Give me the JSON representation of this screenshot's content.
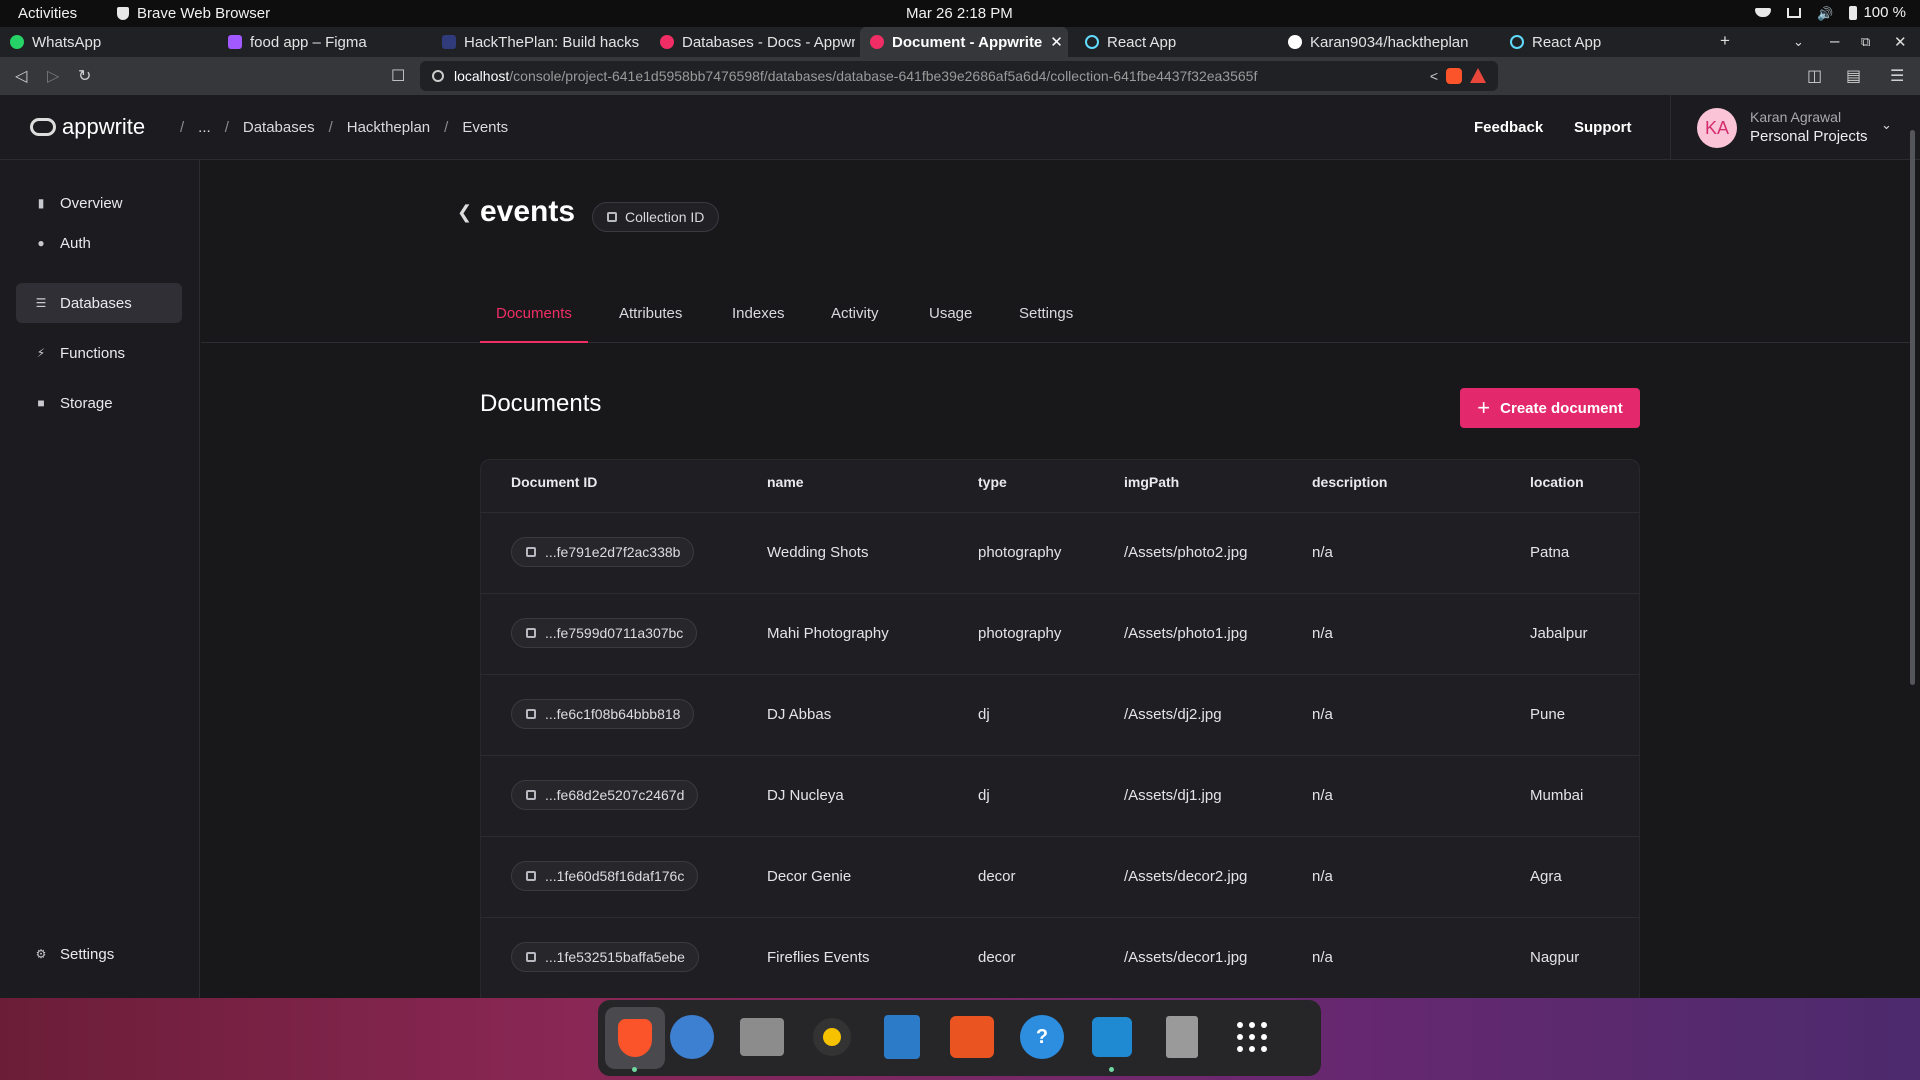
{
  "system": {
    "activities": "Activities",
    "app_name": "Brave Web Browser",
    "clock": "Mar 26  2:18 PM",
    "battery": "100 %"
  },
  "browser": {
    "tabs": [
      {
        "title": "WhatsApp",
        "color": "#25d366"
      },
      {
        "title": "food app – Figma",
        "color": "#a259ff"
      },
      {
        "title": "HackThePlan: Build hacks",
        "color": "#2f3b7a"
      },
      {
        "title": "Databases - Docs - Appwri",
        "color": "#f02e65"
      },
      {
        "title": "Document - Appwrite",
        "color": "#f02e65"
      },
      {
        "title": "React App",
        "color": "#61dafb"
      },
      {
        "title": "Karan9034/hacktheplan",
        "color": "#ffffff"
      },
      {
        "title": "React App",
        "color": "#61dafb"
      }
    ],
    "url_host": "localhost",
    "url_path": "/console/project-641e1d5958bb7476598f/databases/database-641fbe39e2686af5a6d4/collection-641fbe4437f32ea3565f"
  },
  "header": {
    "logo_text": "appwrite",
    "breadcrumbs": [
      "...",
      "Databases",
      "Hacktheplan",
      "Events"
    ],
    "feedback": "Feedback",
    "support": "Support",
    "user_initials": "KA",
    "user_name": "Karan Agrawal",
    "user_org": "Personal Projects"
  },
  "sidebar": {
    "items": [
      {
        "label": "Overview",
        "icon": "bar-chart-icon"
      },
      {
        "label": "Auth",
        "icon": "users-icon"
      },
      {
        "label": "Databases",
        "icon": "database-icon"
      },
      {
        "label": "Functions",
        "icon": "lightning-icon"
      },
      {
        "label": "Storage",
        "icon": "folder-icon"
      }
    ],
    "settings": "Settings"
  },
  "collection": {
    "title": "events",
    "id_label": "Collection ID",
    "tabs": [
      "Documents",
      "Attributes",
      "Indexes",
      "Activity",
      "Usage",
      "Settings"
    ],
    "active_tab": "Documents"
  },
  "documents": {
    "heading": "Documents",
    "create_label": "Create document",
    "columns": [
      "Document ID",
      "name",
      "type",
      "imgPath",
      "description",
      "location"
    ],
    "rows": [
      {
        "id": "...fe791e2d7f2ac338b",
        "name": "Wedding Shots",
        "type": "photography",
        "imgPath": "/Assets/photo2.jpg",
        "description": "n/a",
        "location": "Patna"
      },
      {
        "id": "...fe7599d0711a307bc",
        "name": "Mahi Photography",
        "type": "photography",
        "imgPath": "/Assets/photo1.jpg",
        "description": "n/a",
        "location": "Jabalpur"
      },
      {
        "id": "...fe6c1f08b64bbb818",
        "name": "DJ Abbas",
        "type": "dj",
        "imgPath": "/Assets/dj2.jpg",
        "description": "n/a",
        "location": "Pune"
      },
      {
        "id": "...fe68d2e5207c2467d",
        "name": "DJ Nucleya",
        "type": "dj",
        "imgPath": "/Assets/dj1.jpg",
        "description": "n/a",
        "location": "Mumbai"
      },
      {
        "id": "...1fe60d58f16daf176c",
        "name": "Decor Genie",
        "type": "decor",
        "imgPath": "/Assets/decor2.jpg",
        "description": "n/a",
        "location": "Agra"
      },
      {
        "id": "...1fe532515baffa5ebe",
        "name": "Fireflies Events",
        "type": "decor",
        "imgPath": "/Assets/decor1.jpg",
        "description": "n/a",
        "location": "Nagpur"
      }
    ]
  },
  "colors": {
    "accent": "#f02e65",
    "button": "#e3296b"
  },
  "dock": {
    "apps": [
      "brave-icon",
      "mail-icon",
      "files-icon",
      "rhythmbox-icon",
      "writer-icon",
      "app-center-icon",
      "help-icon",
      "vscode-icon",
      "trash-icon",
      "app-grid-icon"
    ]
  }
}
